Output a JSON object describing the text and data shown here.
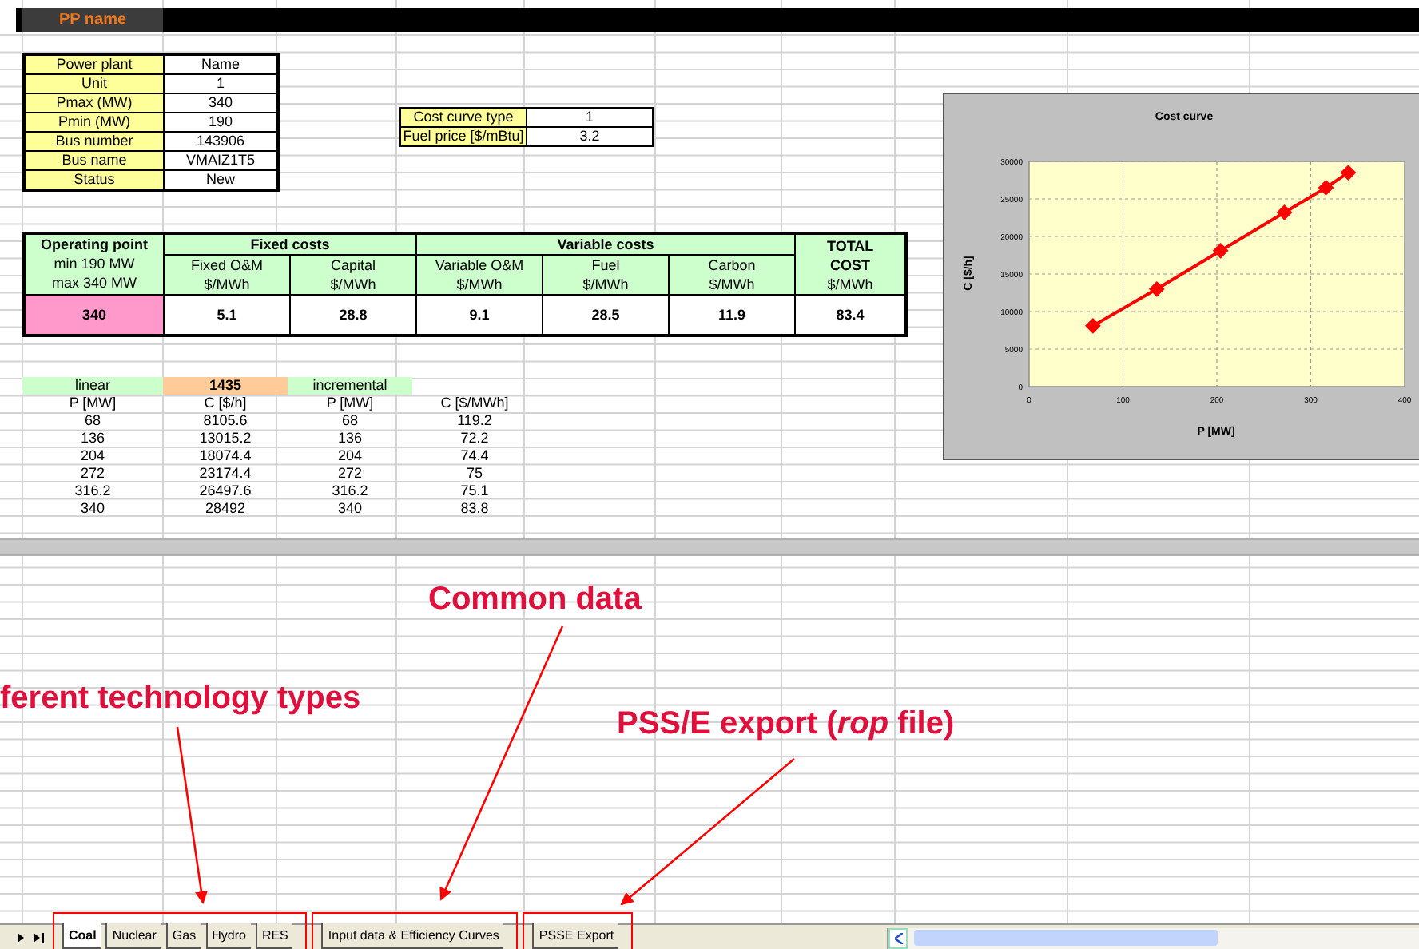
{
  "sheet": {
    "title_cell": "PP name",
    "info_table": [
      {
        "label": "Power plant",
        "value": "Name"
      },
      {
        "label": "Unit",
        "value": "1"
      },
      {
        "label": "Pmax (MW)",
        "value": "340"
      },
      {
        "label": "Pmin (MW)",
        "value": "190"
      },
      {
        "label": "Bus number",
        "value": "143906"
      },
      {
        "label": "Bus name",
        "value": "VMAIZ1T5"
      },
      {
        "label": "Status",
        "value": "New"
      }
    ],
    "curve_settings": [
      {
        "label": "Cost curve type",
        "value": "1"
      },
      {
        "label": "Fuel price [$/mBtu]",
        "value": "3.2"
      }
    ],
    "cost_table": {
      "operating_point": {
        "header": "Operating point",
        "min": "min 190 MW",
        "max": "max 340 MW",
        "value": "340"
      },
      "groups": [
        {
          "title": "Fixed costs",
          "columns": [
            {
              "name": "Fixed O&M",
              "unit": "$/MWh",
              "value": "5.1"
            },
            {
              "name": "Capital",
              "unit": "$/MWh",
              "value": "28.8"
            }
          ]
        },
        {
          "title": "Variable costs",
          "columns": [
            {
              "name": "Variable O&M",
              "unit": "$/MWh",
              "value": "9.1"
            },
            {
              "name": "Fuel",
              "unit": "$/MWh",
              "value": "28.5"
            },
            {
              "name": "Carbon",
              "unit": "$/MWh",
              "value": "11.9"
            }
          ]
        }
      ],
      "total": {
        "title": "TOTAL COST",
        "unit": "$/MWh",
        "value": "83.4"
      }
    },
    "curve_table": {
      "labels": [
        {
          "text": "linear",
          "kind": "mode"
        },
        {
          "text": "1435",
          "kind": "value"
        },
        {
          "text": "incremental",
          "kind": "mode"
        }
      ],
      "columns": [
        "P [MW]",
        "C [$/h]",
        "P [MW]",
        "C [$/MWh]"
      ],
      "rows": [
        [
          "68",
          "8105.6",
          "68",
          "119.2"
        ],
        [
          "136",
          "13015.2",
          "136",
          "72.2"
        ],
        [
          "204",
          "18074.4",
          "204",
          "74.4"
        ],
        [
          "272",
          "23174.4",
          "272",
          "75"
        ],
        [
          "316.2",
          "26497.6",
          "316.2",
          "75.1"
        ],
        [
          "340",
          "28492",
          "340",
          "83.8"
        ]
      ]
    }
  },
  "chart": {
    "chart_data": {
      "type": "line",
      "title": "Cost curve",
      "xlabel": "P [MW]",
      "ylabel": "C [$/h]",
      "x": [
        68,
        136,
        204,
        272,
        316.2,
        340
      ],
      "series": [
        {
          "color": "#ff0000",
          "marker": "diamond",
          "values": [
            8100,
            13000,
            18100,
            23200,
            26500,
            28500
          ]
        }
      ],
      "grid": true,
      "xlim": [
        0,
        400
      ],
      "ylim": [
        0,
        30000
      ],
      "xticks": [
        0,
        100,
        200,
        300,
        400
      ],
      "yticks": [
        0,
        5000,
        10000,
        15000,
        20000,
        25000,
        30000
      ]
    }
  },
  "tabs": [
    {
      "label": "Coal",
      "selected": true
    },
    {
      "label": "Nuclear",
      "selected": false
    },
    {
      "label": "Gas",
      "selected": false
    },
    {
      "label": "Hydro",
      "selected": false
    },
    {
      "label": "RES",
      "selected": false
    },
    {
      "label": "Input data & Efficiency Curves",
      "selected": false
    },
    {
      "label": "PSSE Export",
      "selected": false
    }
  ],
  "annotations": [
    {
      "text": "ferent technology types"
    },
    {
      "text": "Common data"
    },
    {
      "text": "PSS/E export (*rop* file)"
    }
  ]
}
